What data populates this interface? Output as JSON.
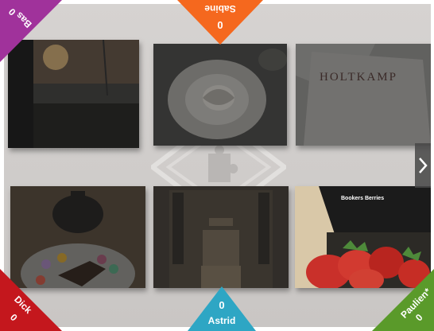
{
  "players": {
    "top_left": {
      "name": "Bas",
      "score": "0",
      "color": "#a0329b"
    },
    "top": {
      "name": "Sabine",
      "score": "0",
      "color": "#f5681e"
    },
    "bottom_left": {
      "name": "Dick",
      "score": "0",
      "color": "#c4171d"
    },
    "bottom": {
      "name": "Astrid",
      "score": "0",
      "color": "#2ea6c4"
    },
    "bottom_right": {
      "name": "Paulien*",
      "score": "0",
      "color": "#5a9a2a"
    }
  },
  "tiles": [
    {
      "id": "sunset-window",
      "icon": "sunset-photo"
    },
    {
      "id": "white-rose",
      "icon": "rose-photo"
    },
    {
      "id": "holtkamp-box",
      "icon": "box-photo",
      "caption": "HOLTKAMP"
    },
    {
      "id": "teapot-cake",
      "icon": "teapot-photo"
    },
    {
      "id": "mirror-reflection",
      "icon": "mirror-photo"
    },
    {
      "id": "strawberries",
      "icon": "strawberry-photo",
      "caption": "Bookers Berries"
    }
  ],
  "navigation": {
    "next_icon": "chevron-right-icon"
  },
  "colors": {
    "board": "#d0cdcb",
    "overlay": "rgba(40,40,40,0.55)"
  }
}
